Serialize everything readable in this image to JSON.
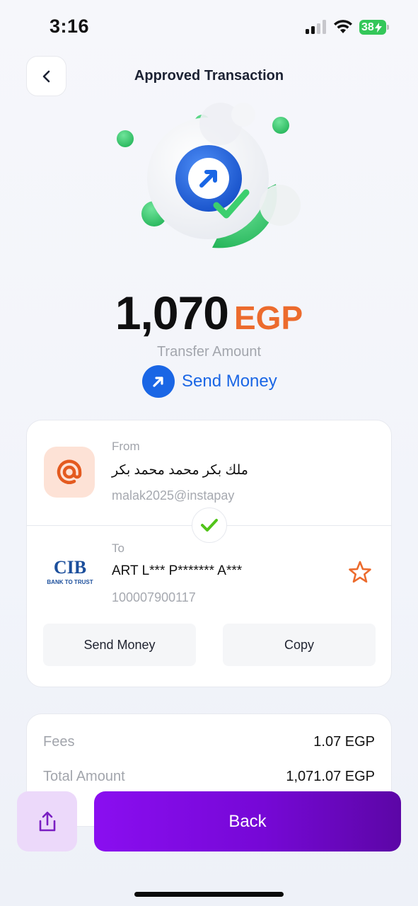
{
  "status_bar": {
    "time": "3:16",
    "battery": "38"
  },
  "header": {
    "title": "Approved Transaction",
    "back_icon": "chevron-left-icon"
  },
  "transfer": {
    "amount": "1,070",
    "currency": "EGP",
    "amount_label": "Transfer Amount",
    "type_label": "Send Money"
  },
  "from": {
    "label": "From",
    "name": "ملك بكر محمد محمد بكر",
    "address": "malak2025@instapay"
  },
  "to": {
    "label": "To",
    "name": "ART L*** P******* A***",
    "account": "100007900117",
    "bank_logo_text": "CIB",
    "bank_tagline": "BANK TO TRUST"
  },
  "actions": {
    "send_money": "Send Money",
    "copy": "Copy"
  },
  "fees": {
    "fees_label": "Fees",
    "fees_value": "1.07 EGP",
    "total_label": "Total Amount",
    "total_value": "1,071.07 EGP"
  },
  "bottom": {
    "back_label": "Back",
    "share_icon": "share-icon"
  },
  "colors": {
    "accent_orange": "#ec6b2d",
    "accent_blue": "#1a66e5",
    "accent_purple": "#7608d6",
    "success_green": "#3ccf6e"
  }
}
